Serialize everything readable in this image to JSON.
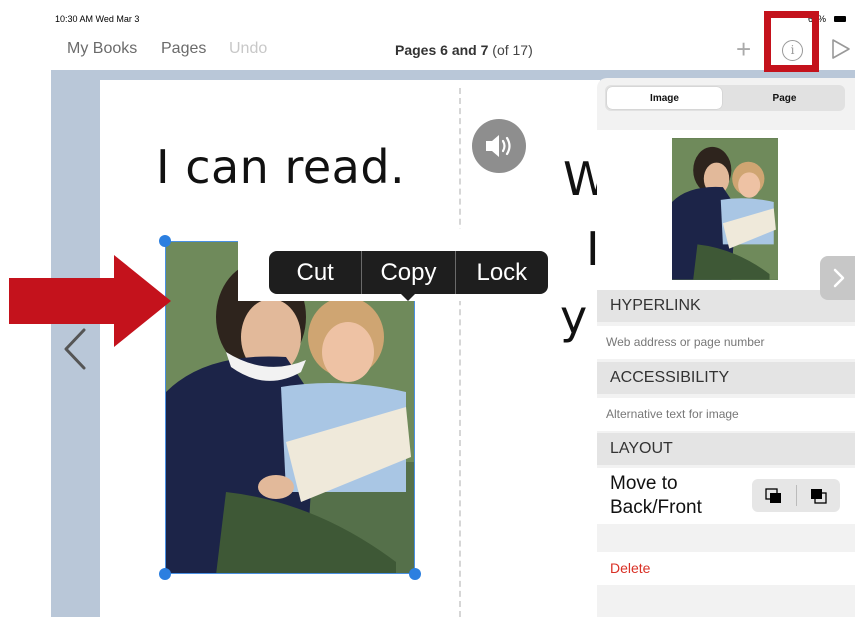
{
  "status_bar": {
    "time": "10:30 AM  Wed Mar 3",
    "battery": "62%"
  },
  "toolbar": {
    "my_books": "My Books",
    "pages": "Pages",
    "undo": "Undo",
    "title_bold": "Pages 6 and 7",
    "title_rest": " (of 17)",
    "icons": [
      "plus-icon",
      "info-icon",
      "play-icon"
    ]
  },
  "canvas": {
    "left_page_text": "I can read.",
    "right_page_fragments": [
      "W",
      "I",
      "y"
    ]
  },
  "context_menu": {
    "items": [
      "Cut",
      "Copy",
      "Lock"
    ]
  },
  "panel": {
    "tabs": [
      "Image",
      "Page"
    ],
    "active_tab": "Image",
    "hyperlink_header": "HYPERLINK",
    "hyperlink_placeholder": "Web address or page number",
    "accessibility_header": "ACCESSIBILITY",
    "accessibility_placeholder": "Alternative text for image",
    "layout_header": "LAYOUT",
    "layout_line1": "Move to",
    "layout_line2": "Back/Front",
    "delete_label": "Delete"
  },
  "colors": {
    "annotation_red": "#c4121c",
    "selection_blue": "#2c7fe0",
    "delete_red": "#d93025",
    "workspace_blue": "#b9c7d8"
  }
}
